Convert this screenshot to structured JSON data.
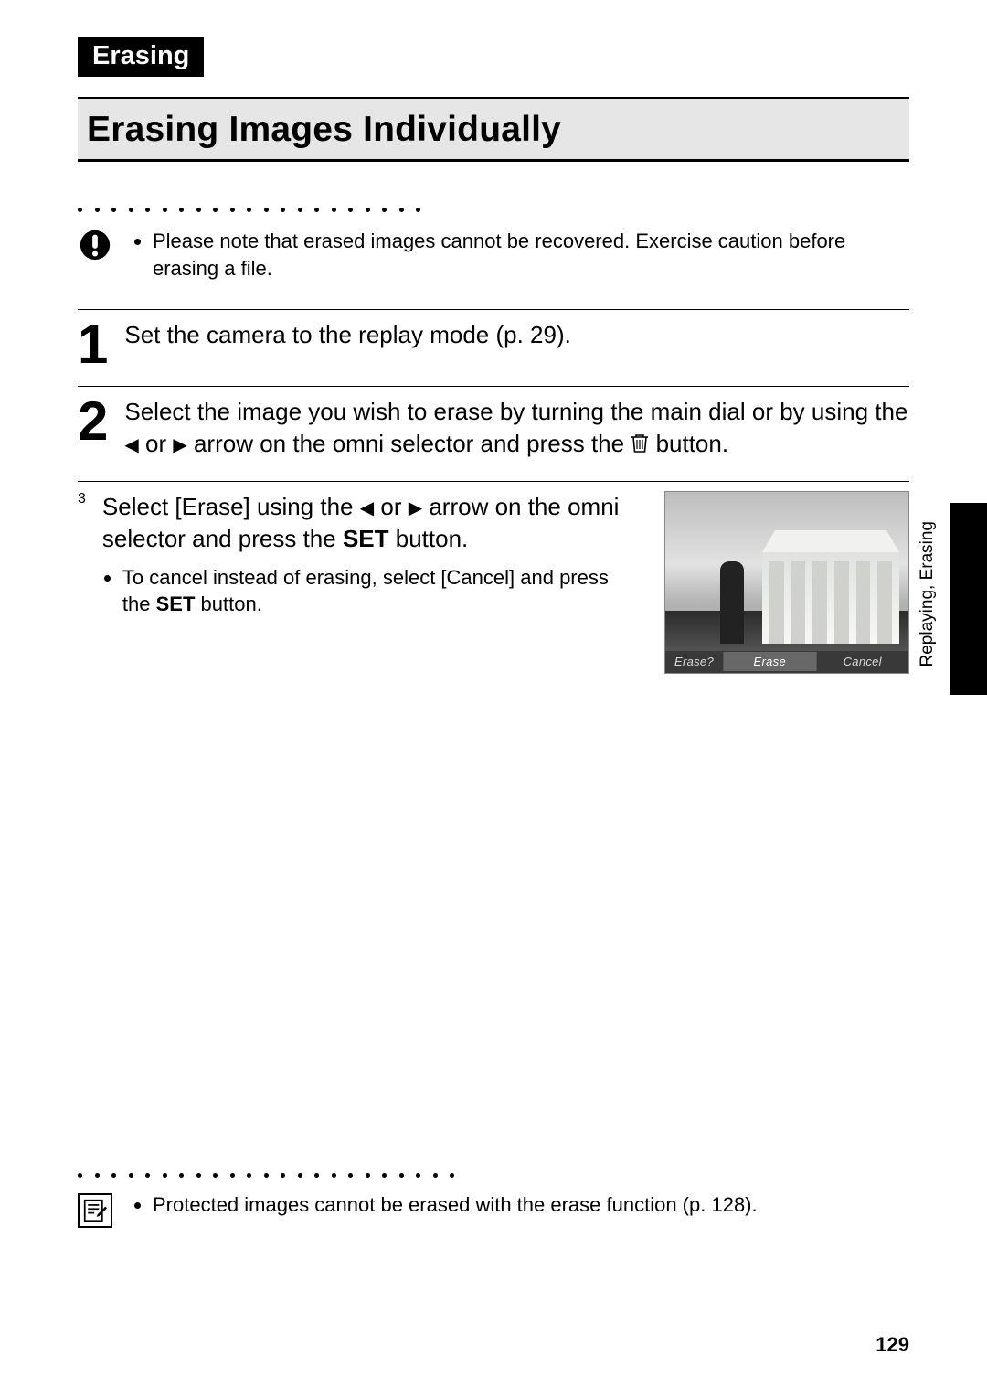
{
  "section_label": "Erasing",
  "title": "Erasing Images Individually",
  "warning": {
    "text": "Please note that erased images cannot be recovered. Exercise caution before erasing a file."
  },
  "steps": {
    "s1": {
      "num": "1",
      "text": "Set the camera to the replay mode (p. 29)."
    },
    "s2": {
      "num": "2",
      "text_a": "Select the image you wish to erase by turning the main dial or by using the ",
      "text_b": " or ",
      "text_c": " arrow on the omni selector and press the ",
      "text_d": " button."
    },
    "s3": {
      "num": "3",
      "head_a": "Select [Erase] using the ",
      "head_b": " or ",
      "head_c": " arrow on the omni selector and press the ",
      "head_d": " button.",
      "set_label": "SET",
      "sub_a": "To cancel instead of erasing, select [Cancel] and press the ",
      "sub_b": " button.",
      "sub_set": "SET"
    }
  },
  "thumb": {
    "prompt": "Erase?",
    "btn_erase": "Erase",
    "btn_cancel": "Cancel"
  },
  "side_tab_text": "Replaying, Erasing",
  "footer_note": "Protected images cannot be erased with the erase function (p. 128).",
  "page_number": "129",
  "glyphs": {
    "left_arrow": "◀",
    "right_arrow": "▶"
  }
}
